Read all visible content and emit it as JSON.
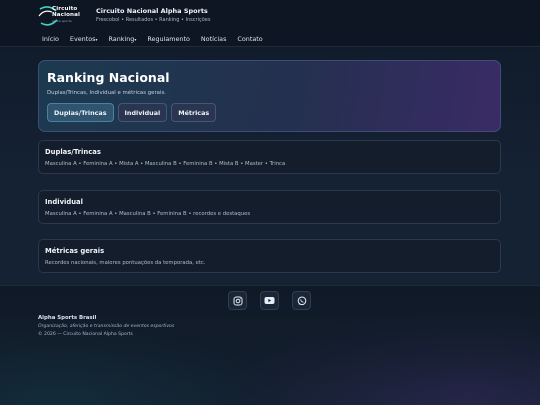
{
  "header": {
    "logo": {
      "line1": "Circuito",
      "line2": "Nacional",
      "tagline": "alpha sports"
    },
    "title": "Circuito Nacional Alpha Sports",
    "subtitle": "Frescobol • Resultados • Ranking • Inscrições"
  },
  "nav": {
    "items": [
      {
        "label": "Início"
      },
      {
        "label": "Eventos",
        "caret": "▾"
      },
      {
        "label": "Ranking",
        "caret": "▾"
      },
      {
        "label": "Regulamento"
      },
      {
        "label": "Notícias"
      },
      {
        "label": "Contato"
      }
    ]
  },
  "hero": {
    "title": "Ranking Nacional",
    "description": "Duplas/Trincas, Individual e métricas gerais.",
    "tabs": [
      {
        "label": "Duplas/Trincas",
        "active": true
      },
      {
        "label": "Individual",
        "active": false
      },
      {
        "label": "Métricas",
        "active": false
      }
    ]
  },
  "cards": [
    {
      "title": "Duplas/Trincas",
      "description": "Masculina A • Feminina A • Mista A • Masculina B • Feminina B • Mista B • Master • Trinca"
    },
    {
      "title": "Individual",
      "description": "Masculina A • Feminina A • Masculina B • Feminina B • recordes e destaques"
    },
    {
      "title": "Métricas gerais",
      "description": "Recordes nacionais, maiores pontuações da temporada, etc."
    }
  ],
  "footer": {
    "socials": [
      {
        "icon": "instagram-icon"
      },
      {
        "icon": "youtube-icon"
      },
      {
        "icon": "whatsapp-icon"
      }
    ],
    "brand": "Alpha Sports Brasil",
    "tagline": "Organização, aferição e transmissão de eventos esportivos",
    "copyright": "© 2026 — Circuito Nacional Alpha Sports"
  },
  "colors": {
    "background": "#142131",
    "header": "#0d1622",
    "accent_teal": "#2f5470",
    "accent_purple": "#3a2b66",
    "logo_teal": "#3fd3c4"
  }
}
